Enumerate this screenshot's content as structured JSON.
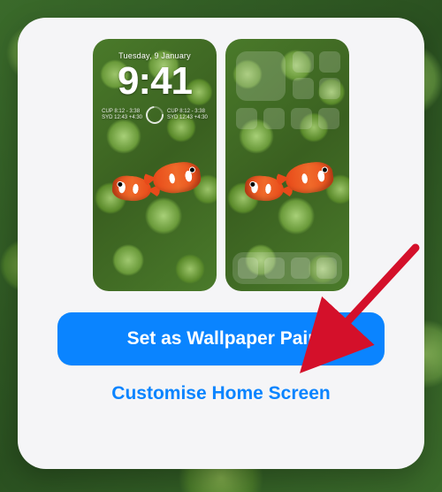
{
  "lock": {
    "date": "Tuesday, 9 January",
    "time": "9:41",
    "widget_left_line1": "CUP  8:12 - 3:38",
    "widget_left_line2": "SYD  12:43 +4:30"
  },
  "actions": {
    "primary": "Set as Wallpaper Pair",
    "secondary": "Customise Home Screen"
  },
  "colors": {
    "accent": "#0a84ff"
  }
}
